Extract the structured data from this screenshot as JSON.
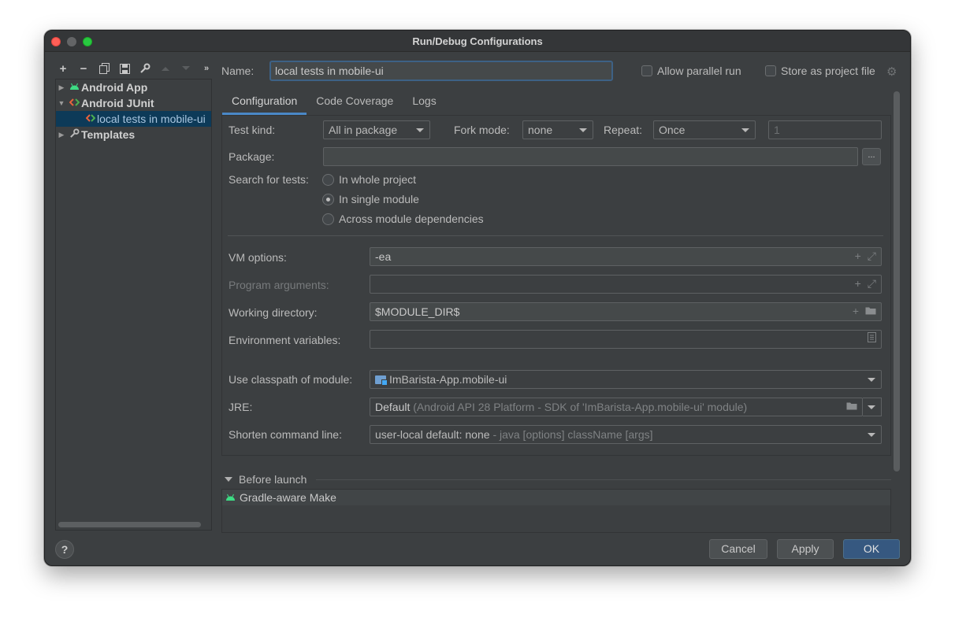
{
  "window": {
    "title": "Run/Debug Configurations"
  },
  "toolbar": {
    "icons": [
      "plus-icon",
      "minus-icon",
      "copy-icon",
      "save-icon",
      "wrench-icon",
      "arrow-up-icon",
      "arrow-down-icon",
      "more-icon"
    ]
  },
  "tree": {
    "items": [
      {
        "label": "Android App"
      },
      {
        "label": "Android JUnit"
      },
      {
        "label": "local tests in mobile-ui"
      },
      {
        "label": "Templates"
      }
    ]
  },
  "header": {
    "name_label": "Name:",
    "name_value": "local tests in mobile-ui",
    "allow_parallel_label": "Allow parallel run",
    "store_project_label": "Store as project file"
  },
  "tabs": [
    "Configuration",
    "Code Coverage",
    "Logs"
  ],
  "config": {
    "test_kind_label": "Test kind:",
    "test_kind_value": "All in package",
    "fork_mode_label": "Fork mode:",
    "fork_mode_value": "none",
    "repeat_label": "Repeat:",
    "repeat_value": "Once",
    "repeat_count": "1",
    "package_label": "Package:",
    "browse_label": "...",
    "search_label": "Search for tests:",
    "search_options": [
      "In whole project",
      "In single module",
      "Across module dependencies"
    ],
    "vm_label": "VM options:",
    "vm_value": "-ea",
    "prog_args_label": "Program arguments:",
    "workdir_label": "Working directory:",
    "workdir_value": "$MODULE_DIR$",
    "env_label": "Environment variables:",
    "classpath_label": "Use classpath of module:",
    "classpath_value": "ImBarista-App.mobile-ui",
    "jre_label": "JRE:",
    "jre_value": "Default",
    "jre_detail": "(Android API 28 Platform - SDK of 'ImBarista-App.mobile-ui' module)",
    "shorten_label": "Shorten command line:",
    "shorten_value": "user-local default: none",
    "shorten_detail": "- java [options] className [args]"
  },
  "before_launch": {
    "title": "Before launch",
    "items": [
      "Gradle-aware Make"
    ]
  },
  "buttons": {
    "help": "?",
    "cancel": "Cancel",
    "apply": "Apply",
    "ok": "OK"
  }
}
